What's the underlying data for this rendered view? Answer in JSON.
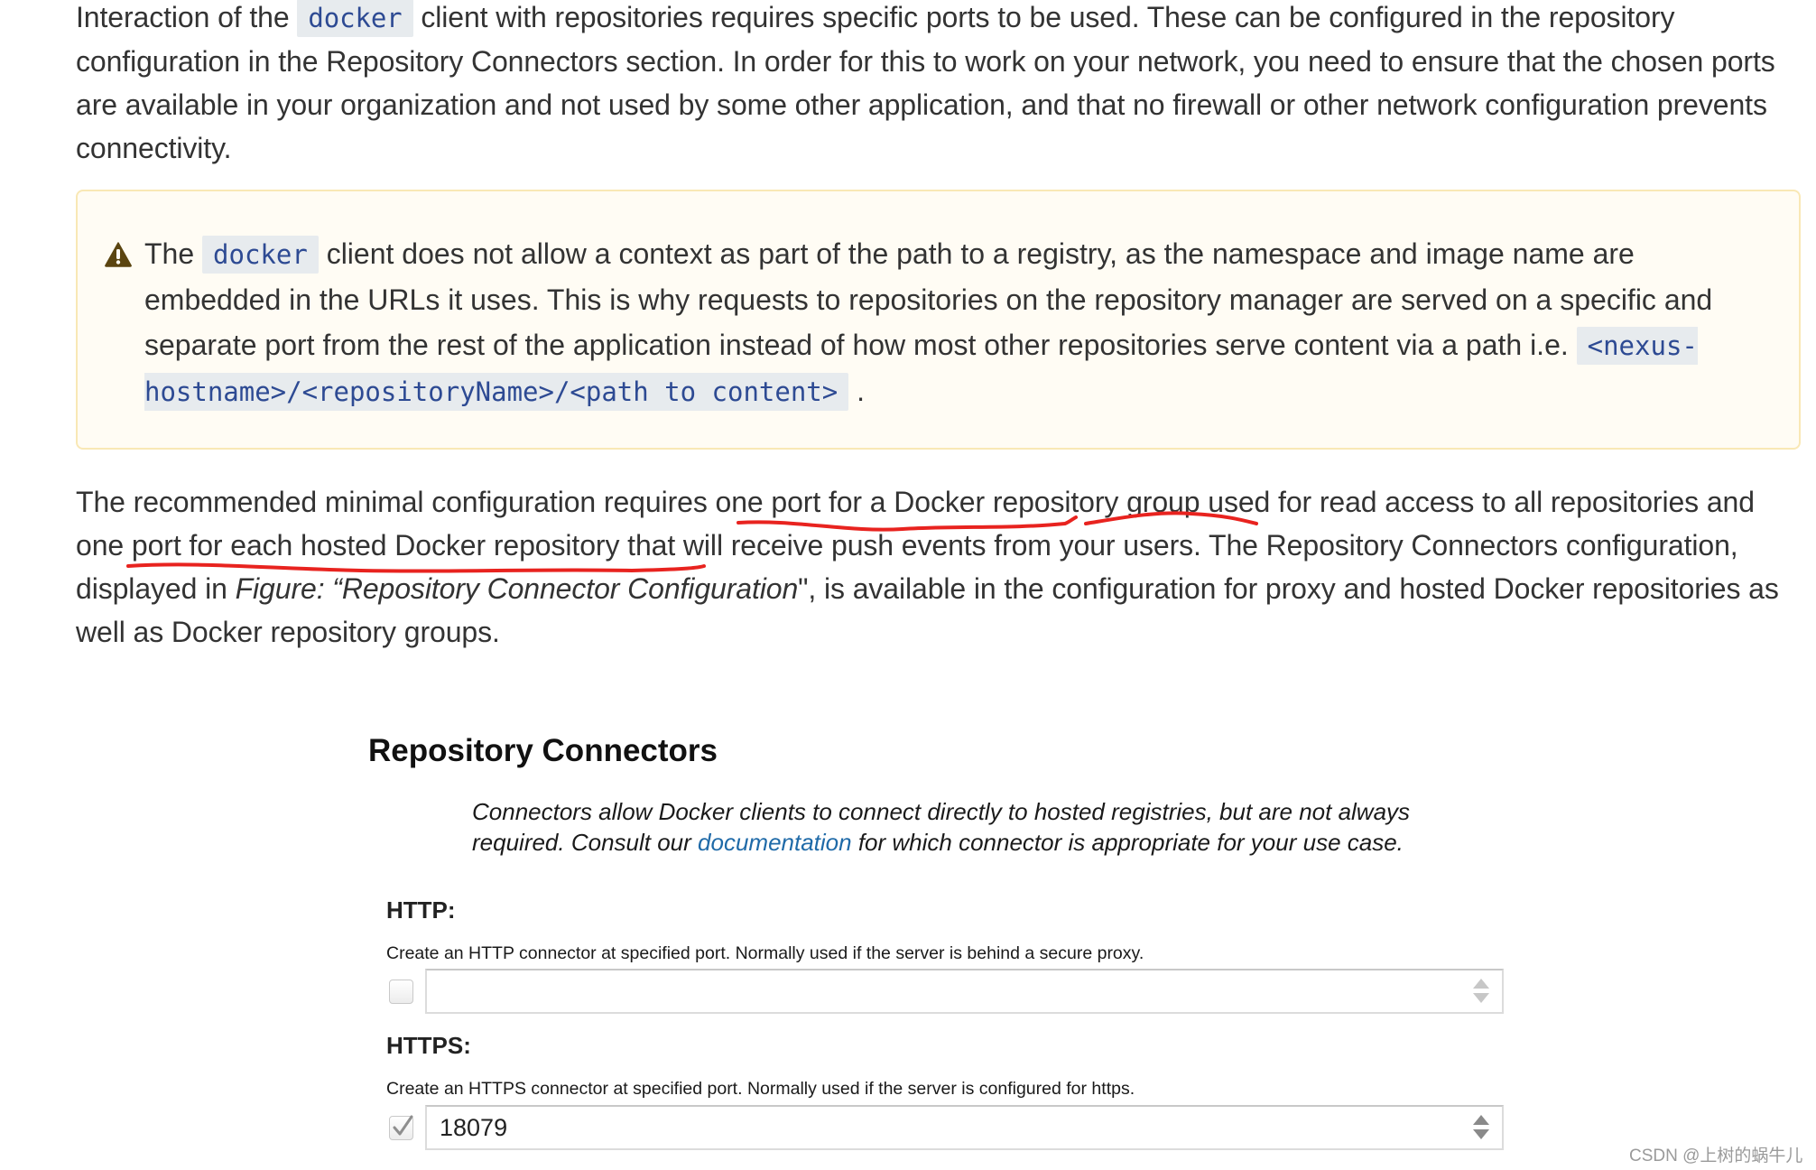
{
  "paragraph1": {
    "before_code": "Interaction of the ",
    "code": "docker",
    "after_code": " client with repositories requires specific ports to be used. These can be configured in the repository configuration in the Repository Connectors section. In order for this to work on your network, you need to ensure that the chosen ports are available in your organization and not used by some other application, and that no firewall or other network configuration prevents connectivity."
  },
  "note": {
    "icon": "warning-icon",
    "text_1": "The ",
    "code_1": "docker",
    "text_2": " client does not allow a context as part of the path to a registry, as the namespace and image name are embedded in the URLs it uses. This is why requests to repositories on the repository manager are served on a specific and separate port from the rest of the application instead of how most other repositories serve content via a path i.e. ",
    "code_2": "<nexus-hostname>/<repositoryName>/<path to content>",
    "text_3": " ."
  },
  "paragraph2": {
    "t1": "The recommended minimal configuration requires ",
    "u1": "one port for a Docker repository group",
    "t2": " used for read access to all repositories and ",
    "u2": "one port for each hosted Docker repository",
    "t3": " that will receive push events from your users. The Repository Connectors configuration, displayed in ",
    "fig_ref": "Figure: “Repository Connector Configuration",
    "t4": "\", is available in the configuration for proxy and hosted Docker repositories as well as Docker repository groups."
  },
  "annotation_color": "#e8231f",
  "figure": {
    "title": "Repository Connectors",
    "description_before": "Connectors allow Docker clients to connect directly to hosted registries, but are not always required. Consult our ",
    "description_link": "documentation",
    "description_after": " for which connector is appropriate for your use case.",
    "link_color": "#1f6aa8",
    "http": {
      "label": "HTTP:",
      "help": "Create an HTTP connector at specified port. Normally used if the server is behind a secure proxy.",
      "checked": false,
      "value": ""
    },
    "https": {
      "label": "HTTPS:",
      "help": "Create an HTTPS connector at specified port. Normally used if the server is configured for https.",
      "checked": true,
      "value": "18079"
    }
  },
  "watermark": "CSDN @上树的蜗牛儿"
}
